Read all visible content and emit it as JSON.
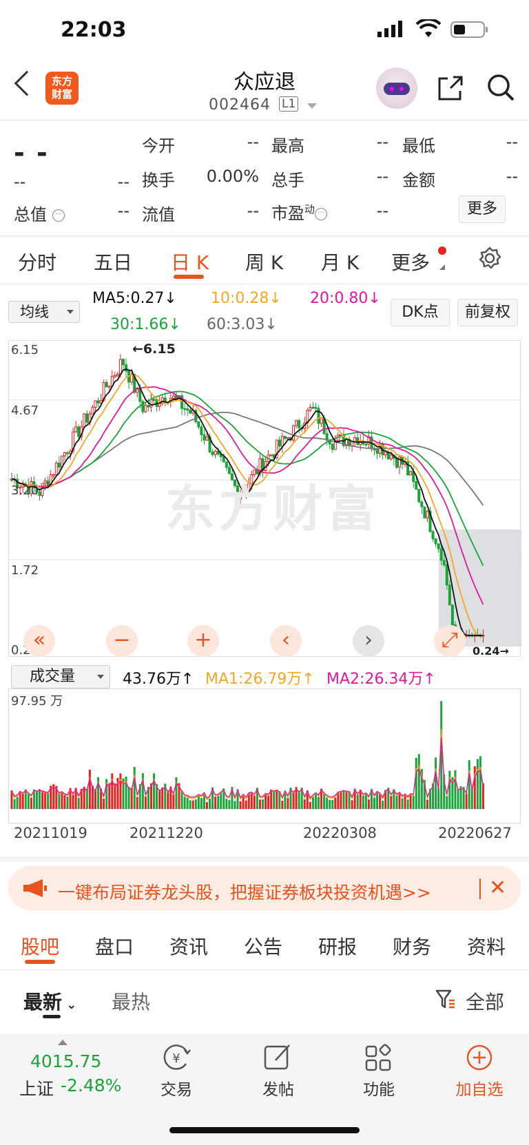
{
  "status": {
    "time": "22:03"
  },
  "header": {
    "logo_line1": "东方",
    "logo_line2": "财富",
    "stock_name": "众应退",
    "stock_code": "002464",
    "level_badge": "L1"
  },
  "quote": {
    "price": "- -",
    "change": "--",
    "change_pct": "--",
    "rows": [
      {
        "l1": "今开",
        "v1": "--",
        "l2": "最高",
        "v2": "--",
        "l3": "最低",
        "v3": "--"
      },
      {
        "l1": "换手",
        "v1": "0.00%",
        "l2": "总手",
        "v2": "--",
        "l3": "金额",
        "v3": "--"
      }
    ],
    "total_value_label": "总值",
    "total_value": "--",
    "float_label": "流值",
    "float_value": "--",
    "pe_label": "市盈",
    "pe_sup": "动",
    "pe_value": "--",
    "more_button": "更多"
  },
  "period_tabs": [
    "分时",
    "五日",
    "日 K",
    "周 K",
    "月 K",
    "更多"
  ],
  "active_period": "日 K",
  "ma_bar": {
    "selector": "均线",
    "ma5": "MA5:0.27↓",
    "ma10": "10:0.28↓",
    "ma20": "20:0.80↓",
    "ma30": "30:1.66↓",
    "ma60": "60:3.03↓",
    "dk_button": "DK点",
    "adjust_button": "前复权"
  },
  "kline": {
    "y_labels": [
      "6.15",
      "4.67",
      "3.20",
      "1.72",
      "0.24"
    ],
    "high_mark": "←6.15",
    "low_mark": "0.24→",
    "watermark": "东方财富",
    "colors": {
      "up": "#e8201e",
      "down": "#1aa33a",
      "ma5": "#111111",
      "ma10": "#f5a623",
      "ma20": "#e0199a",
      "ma30": "#1aa33a",
      "ma60": "#777777"
    }
  },
  "chart_controls": [
    "«",
    "−",
    "+",
    "‹",
    "›",
    "⤢"
  ],
  "volume_bar": {
    "selector": "成交量",
    "vol": "43.76万↑",
    "ma1": "MA1:26.79万↑",
    "ma2": "MA2:26.34万↑",
    "max_label": "97.95 万"
  },
  "dates": [
    "20211019",
    "20211220",
    "20220308",
    "20220627"
  ],
  "banner": {
    "text": "一键布局证券龙头股，把握证券板块投资机遇>>",
    "close": "✕"
  },
  "sub_tabs": [
    "股吧",
    "盘口",
    "资讯",
    "公告",
    "研报",
    "财务",
    "资料"
  ],
  "active_sub_tab": "股吧",
  "feed_filters": {
    "latest": "最新",
    "hot": "最热",
    "all": "全部"
  },
  "bottom_bar": {
    "index_value": "4015.75",
    "index_name": "上证",
    "index_pct": "-2.48%",
    "nav": [
      {
        "label": "交易",
        "icon": "trade-icon"
      },
      {
        "label": "发帖",
        "icon": "post-icon"
      },
      {
        "label": "功能",
        "icon": "apps-icon"
      },
      {
        "label": "加自选",
        "icon": "add-watch-icon"
      }
    ]
  }
}
